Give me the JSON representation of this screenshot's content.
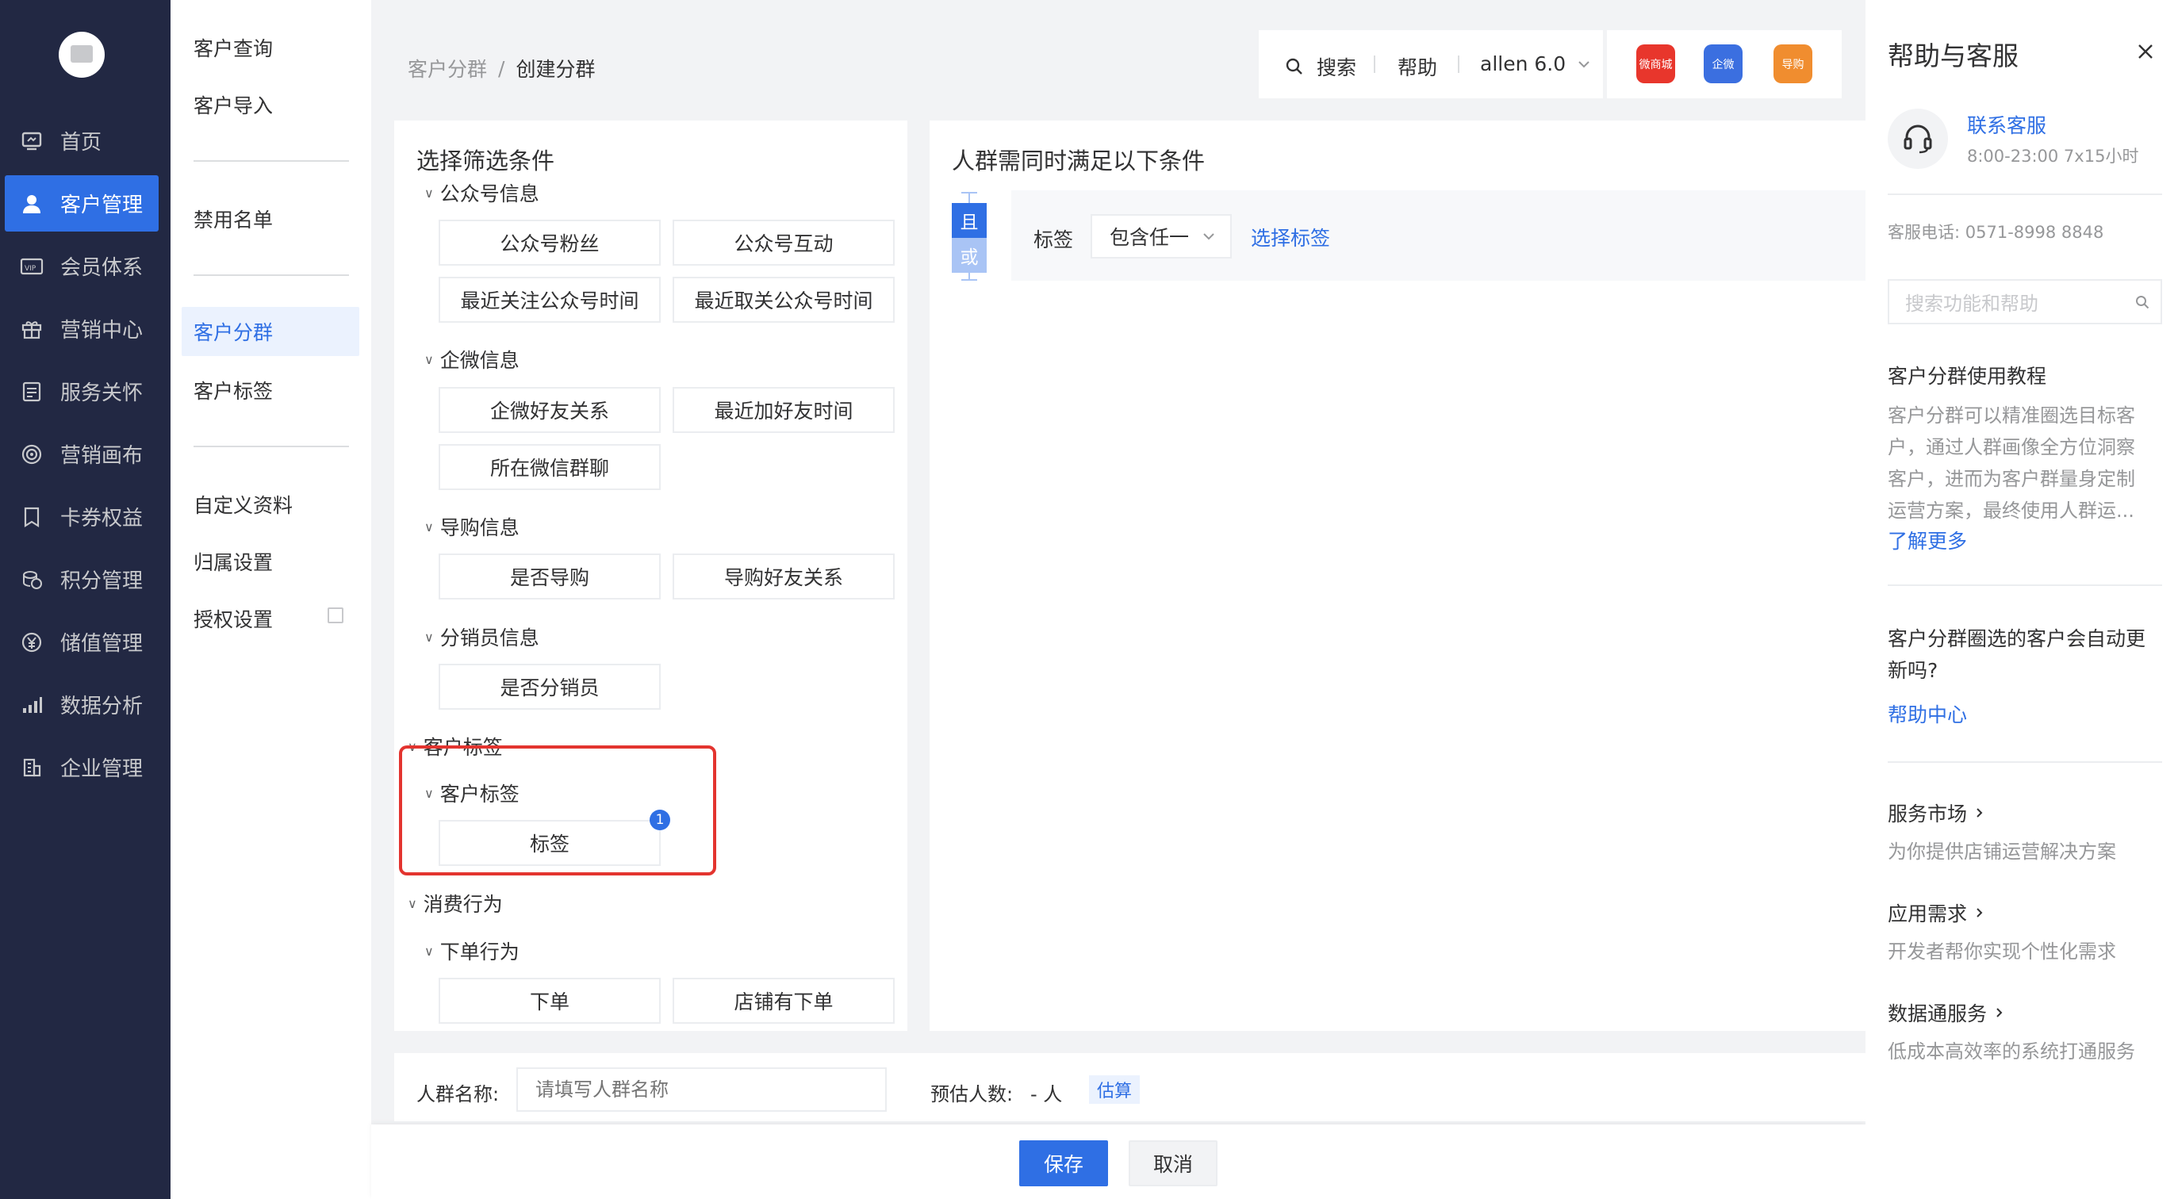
{
  "sidebar": {
    "items": [
      {
        "label": "首页",
        "icon": "home-screen-icon"
      },
      {
        "label": "客户管理",
        "icon": "user-icon"
      },
      {
        "label": "会员体系",
        "icon": "vip-card-icon"
      },
      {
        "label": "营销中心",
        "icon": "gift-icon"
      },
      {
        "label": "服务关怀",
        "icon": "notebook-icon"
      },
      {
        "label": "营销画布",
        "icon": "target-icon"
      },
      {
        "label": "卡券权益",
        "icon": "coupon-icon"
      },
      {
        "label": "积分管理",
        "icon": "coins-icon"
      },
      {
        "label": "储值管理",
        "icon": "yen-icon"
      },
      {
        "label": "数据分析",
        "icon": "bar-chart-icon"
      },
      {
        "label": "企业管理",
        "icon": "building-icon"
      }
    ],
    "active_label": "客户管理"
  },
  "subnav": {
    "items": [
      "客户查询",
      "客户导入",
      "禁用名单",
      "客户分群",
      "客户标签",
      "自定义资料",
      "归属设置",
      "授权设置"
    ],
    "active": "客户分群"
  },
  "breadcrumb": {
    "parent": "客户分群",
    "sep": "/",
    "current": "创建分群"
  },
  "topbar": {
    "search": "搜索",
    "help": "帮助",
    "account": "allen 6.0",
    "apps": [
      {
        "label": "微商城",
        "color": "#e8362c"
      },
      {
        "label": "企微",
        "color": "#3b6fe0"
      },
      {
        "label": "导购",
        "color": "#f08d2f"
      }
    ]
  },
  "filter_panel": {
    "title": "选择筛选条件",
    "groups": {
      "g1": {
        "name": "公众号信息",
        "buttons": [
          "公众号粉丝",
          "公众号互动",
          "最近关注公众号时间",
          "最近取关公众号时间"
        ]
      },
      "g2": {
        "name": "企微信息",
        "buttons": [
          "企微好友关系",
          "最近加好友时间",
          "所在微信群聊"
        ]
      },
      "g3": {
        "name": "导购信息",
        "buttons": [
          "是否导购",
          "导购好友关系"
        ]
      },
      "g4": {
        "name": "分销员信息",
        "buttons": [
          "是否分销员"
        ]
      },
      "g5_parent": "客户标签",
      "g5": {
        "name": "客户标签",
        "buttons": [
          "标签"
        ],
        "badge": "1"
      },
      "g6_parent": "消费行为",
      "g6": {
        "name": "下单行为",
        "buttons": [
          "下单",
          "店铺有下单"
        ]
      }
    }
  },
  "conditions": {
    "title": "人群需同时满足以下条件",
    "logic_and": "且",
    "logic_or": "或",
    "row": {
      "field": "标签",
      "operator": "包含任一",
      "action": "选择标签"
    }
  },
  "bottom_form": {
    "name_label": "人群名称:",
    "name_placeholder": "请填写人群名称",
    "estimate_label": "预估人数:",
    "estimate_value": "- 人",
    "estimate_button": "估算"
  },
  "actions": {
    "save": "保存",
    "cancel": "取消"
  },
  "help_panel": {
    "title": "帮助与客服",
    "contact_title": "联系客服",
    "contact_hours": "8:00-23:00  7x15小时",
    "phone": "客服电话: 0571-8998 8848",
    "search_placeholder": "搜索功能和帮助",
    "tutorial_title": "客户分群使用教程",
    "tutorial_lines": [
      "客户分群可以精准圈选目标客",
      "户，通过人群画像全方位洞察",
      "客户，进而为客户群量身定制",
      "运营方案，最终使用人群运..."
    ],
    "learn_more": "了解更多",
    "faq_lines": [
      "客户分群圈选的客户会自动更",
      "新吗?"
    ],
    "help_center": "帮助中心",
    "links": [
      {
        "title": "服务市场",
        "desc": "为你提供店铺运营解决方案"
      },
      {
        "title": "应用需求",
        "desc": "开发者帮你实现个性化需求"
      },
      {
        "title": "数据通服务",
        "desc": "低成本高效率的系统打通服务"
      }
    ]
  }
}
